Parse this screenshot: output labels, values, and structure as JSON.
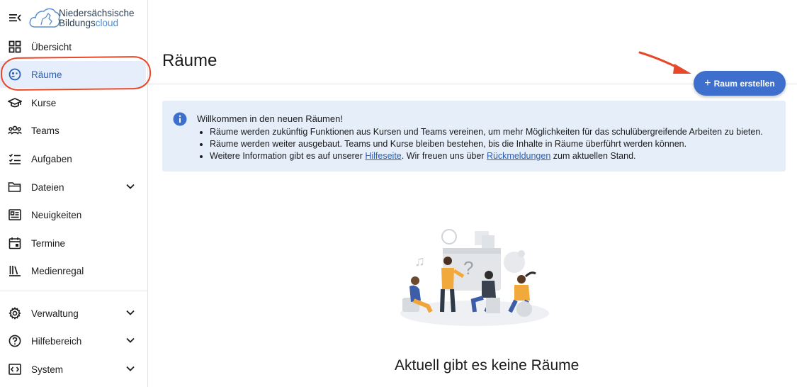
{
  "brand": {
    "line1": "Niedersächsische",
    "line2_a": "Bildungs",
    "line2_b": "cloud"
  },
  "sidebar": {
    "items": [
      {
        "label": "Übersicht",
        "icon": "grid-icon"
      },
      {
        "label": "Räume",
        "icon": "rooms-icon"
      },
      {
        "label": "Kurse",
        "icon": "graduation-cap-icon"
      },
      {
        "label": "Teams",
        "icon": "people-icon"
      },
      {
        "label": "Aufgaben",
        "icon": "task-list-icon"
      },
      {
        "label": "Dateien",
        "icon": "folder-icon"
      },
      {
        "label": "Neuigkeiten",
        "icon": "news-icon"
      },
      {
        "label": "Termine",
        "icon": "calendar-icon"
      },
      {
        "label": "Medienregal",
        "icon": "library-icon"
      },
      {
        "label": "Verwaltung",
        "icon": "gear-icon"
      },
      {
        "label": "Hilfebereich",
        "icon": "help-icon"
      },
      {
        "label": "System",
        "icon": "code-icon"
      }
    ],
    "active": "Räume"
  },
  "main": {
    "title": "Räume",
    "create_button": "Raum erstellen",
    "info": {
      "title": "Willkommen in den neuen Räumen!",
      "bullet1": "Räume werden zukünftig Funktionen aus Kursen und Teams vereinen, um mehr Möglichkeiten für das schulübergreifende Arbeiten zu bieten.",
      "bullet2": "Räume werden weiter ausgebaut. Teams und Kurse bleiben bestehen, bis die Inhalte in Räume überführt werden können.",
      "bullet3_a": "Weitere Information gibt es auf unserer ",
      "bullet3_link1": "Hilfeseite",
      "bullet3_b": ". Wir freuen uns über ",
      "bullet3_link2": "Rückmeldungen",
      "bullet3_c": " zum aktuellen Stand."
    },
    "empty_state": "Aktuell gibt es keine Räume"
  },
  "colors": {
    "accent": "#3e6fcc",
    "active_bg": "#e6eefb",
    "info_bg": "#e6eefa",
    "annotation": "#e8482a"
  }
}
